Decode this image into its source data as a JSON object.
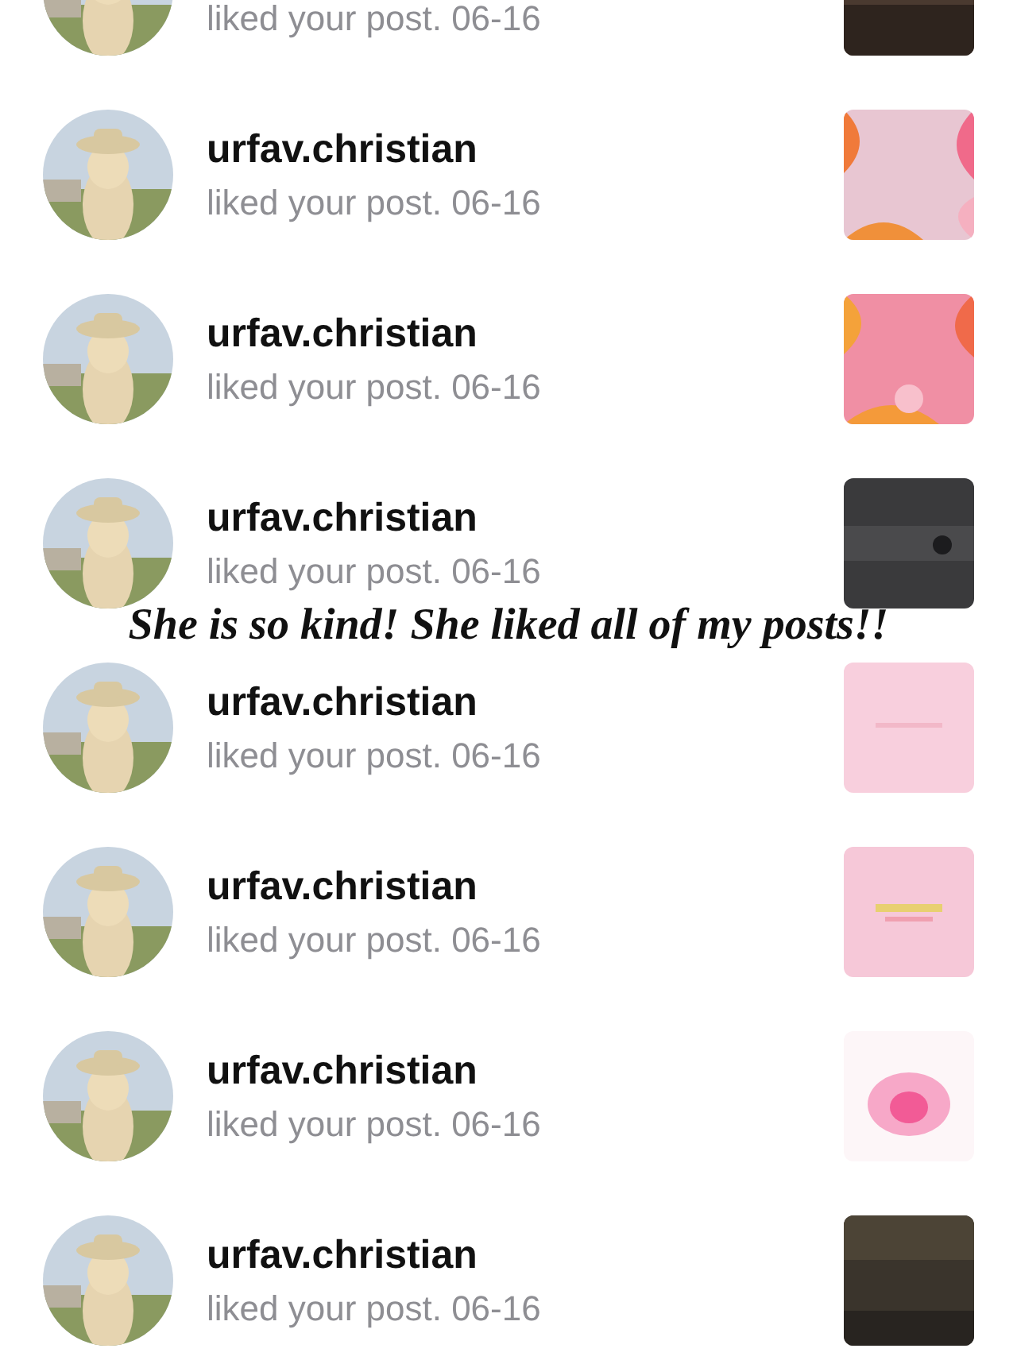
{
  "caption": "She is so kind! She liked all of my posts!!",
  "notifications": [
    {
      "detail": "liked your post. 06-16"
    },
    {
      "user": "urfav.christian",
      "detail": "liked your post. 06-16"
    },
    {
      "user": "urfav.christian",
      "detail": "liked your post. 06-16"
    },
    {
      "user": "urfav.christian",
      "detail": "liked your post. 06-16"
    },
    {
      "user": "urfav.christian",
      "detail": "liked your post. 06-16"
    },
    {
      "user": "urfav.christian",
      "detail": "liked your post. 06-16"
    },
    {
      "user": "urfav.christian",
      "detail": "liked your post. 06-16"
    },
    {
      "user": "urfav.christian",
      "detail": "liked your post. 06-16"
    }
  ]
}
